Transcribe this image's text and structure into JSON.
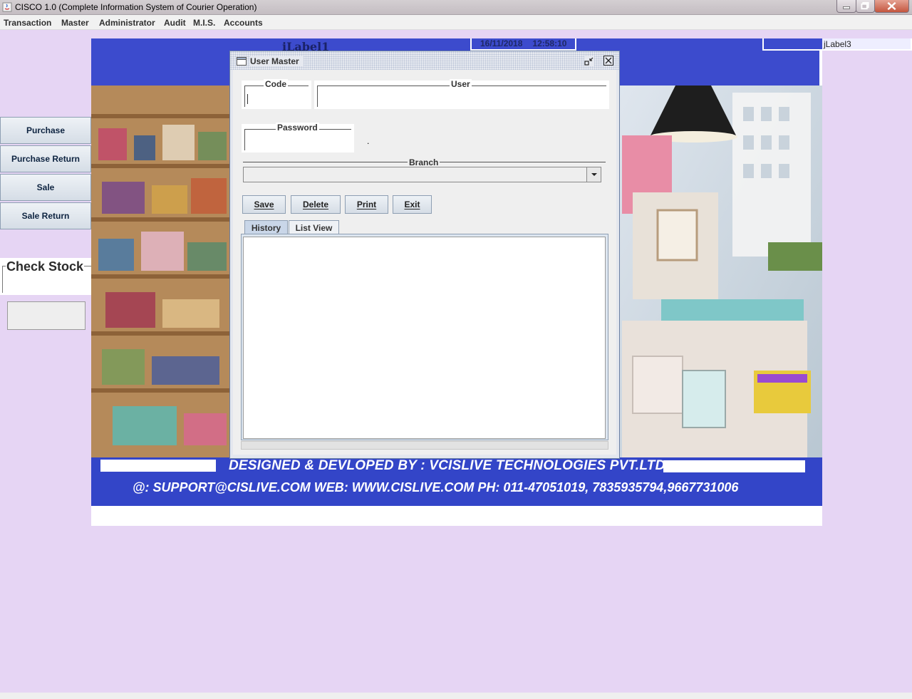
{
  "window": {
    "title": "CISCO 1.0 (Complete Information System of Courier Operation)",
    "controls": [
      "minimize-icon",
      "maximize-icon",
      "close-icon"
    ]
  },
  "menubar": {
    "items": [
      {
        "label": "Transaction"
      },
      {
        "label": "Master"
      },
      {
        "label": "Administrator"
      },
      {
        "label": "Audit"
      },
      {
        "label": "M.I.S."
      },
      {
        "label": "Accounts"
      }
    ]
  },
  "sidebar": {
    "buttons": [
      {
        "label": "Purchase"
      },
      {
        "label": "Purchase Return"
      },
      {
        "label": "Sale"
      },
      {
        "label": "Sale Return"
      }
    ],
    "check_stock_label": "Check Stock"
  },
  "header": {
    "ilabel1": "iLabel1",
    "date": "16/11/2018",
    "time": "12:58:10",
    "jlabel3": "jLabel3"
  },
  "footer": {
    "line1": "DESIGNED & DEVLOPED BY : VCISLIVE TECHNOLOGIES PVT.LTD",
    "line2": "@: SUPPORT@CISLIVE.COM    WEB: WWW.CISLIVE.COM    PH:  011-47051019, 7835935794,9667731006"
  },
  "dialog": {
    "title": "User Master",
    "fields": {
      "code_label": "Code",
      "code_value": "",
      "user_label": "User",
      "user_value": "",
      "password_label": "Password",
      "password_value": "",
      "password_hint": ".",
      "branch_label": "Branch",
      "branch_value": ""
    },
    "buttons": {
      "save": "Save",
      "delete": "Delete",
      "print": "Print",
      "exit": "Exit"
    },
    "tabs": [
      {
        "label": "History",
        "selected": true
      },
      {
        "label": "List View",
        "selected": false
      }
    ]
  },
  "colors": {
    "desktop": "#e6d5f4",
    "brand_blue": "#3c4bcd",
    "button_border": "#8e9fb3"
  }
}
